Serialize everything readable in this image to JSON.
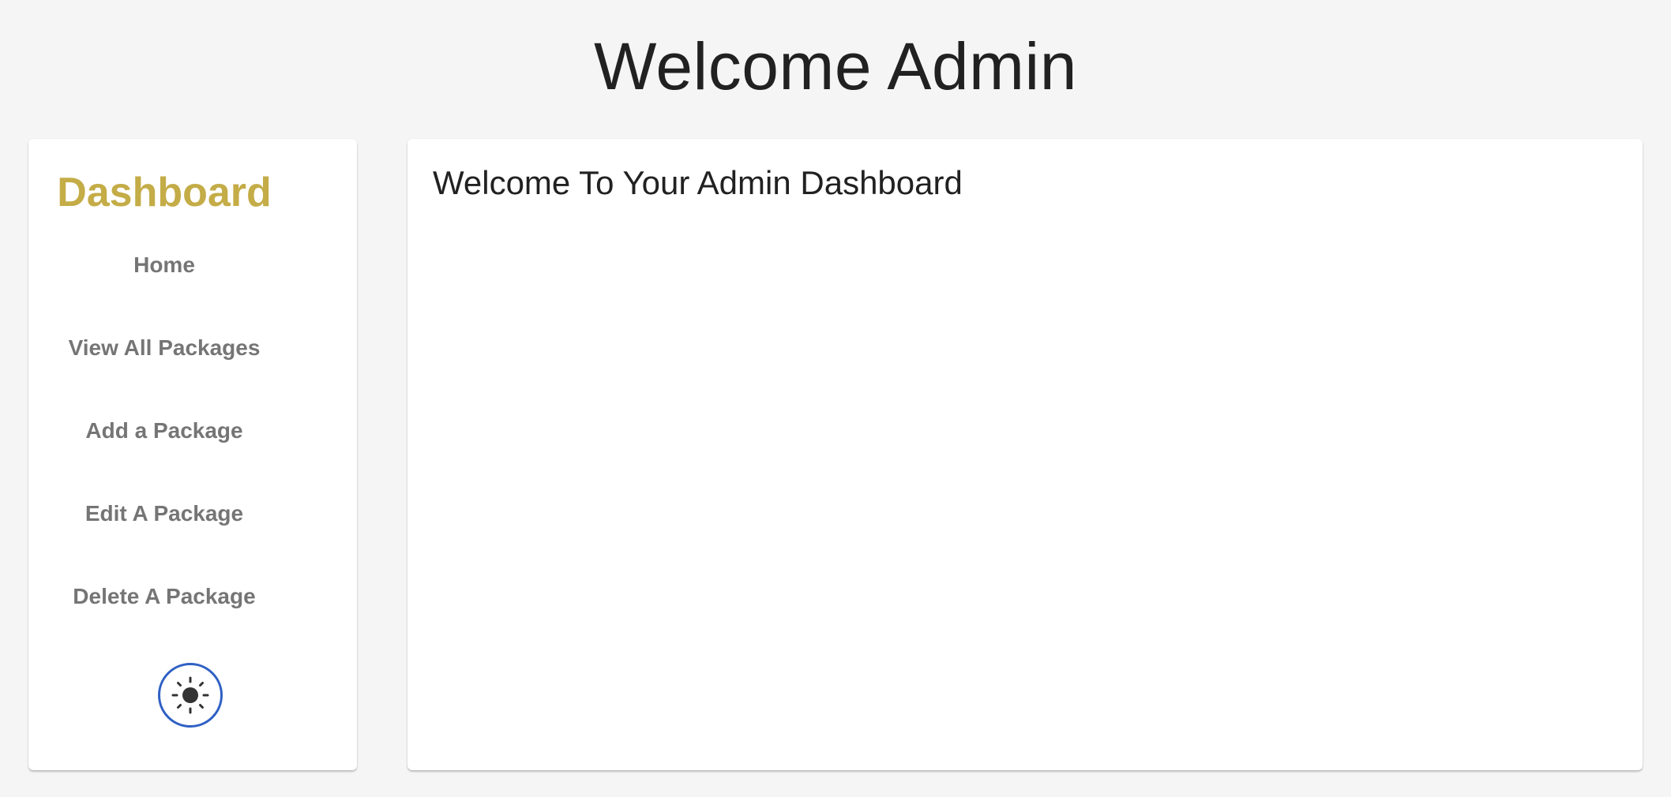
{
  "header": {
    "title": "Welcome Admin"
  },
  "sidebar": {
    "title": "Dashboard",
    "items": [
      {
        "label": "Home"
      },
      {
        "label": "View All Packages"
      },
      {
        "label": "Add a Package"
      },
      {
        "label": "Edit A Package"
      },
      {
        "label": "Delete A Package"
      }
    ],
    "theme_toggle_icon": "sun-icon"
  },
  "main": {
    "heading": "Welcome To Your Admin Dashboard"
  },
  "colors": {
    "background": "#f5f5f5",
    "brand_gold": "#c4ac47",
    "nav_text": "#757575",
    "toggle_border": "#2f60c4"
  }
}
